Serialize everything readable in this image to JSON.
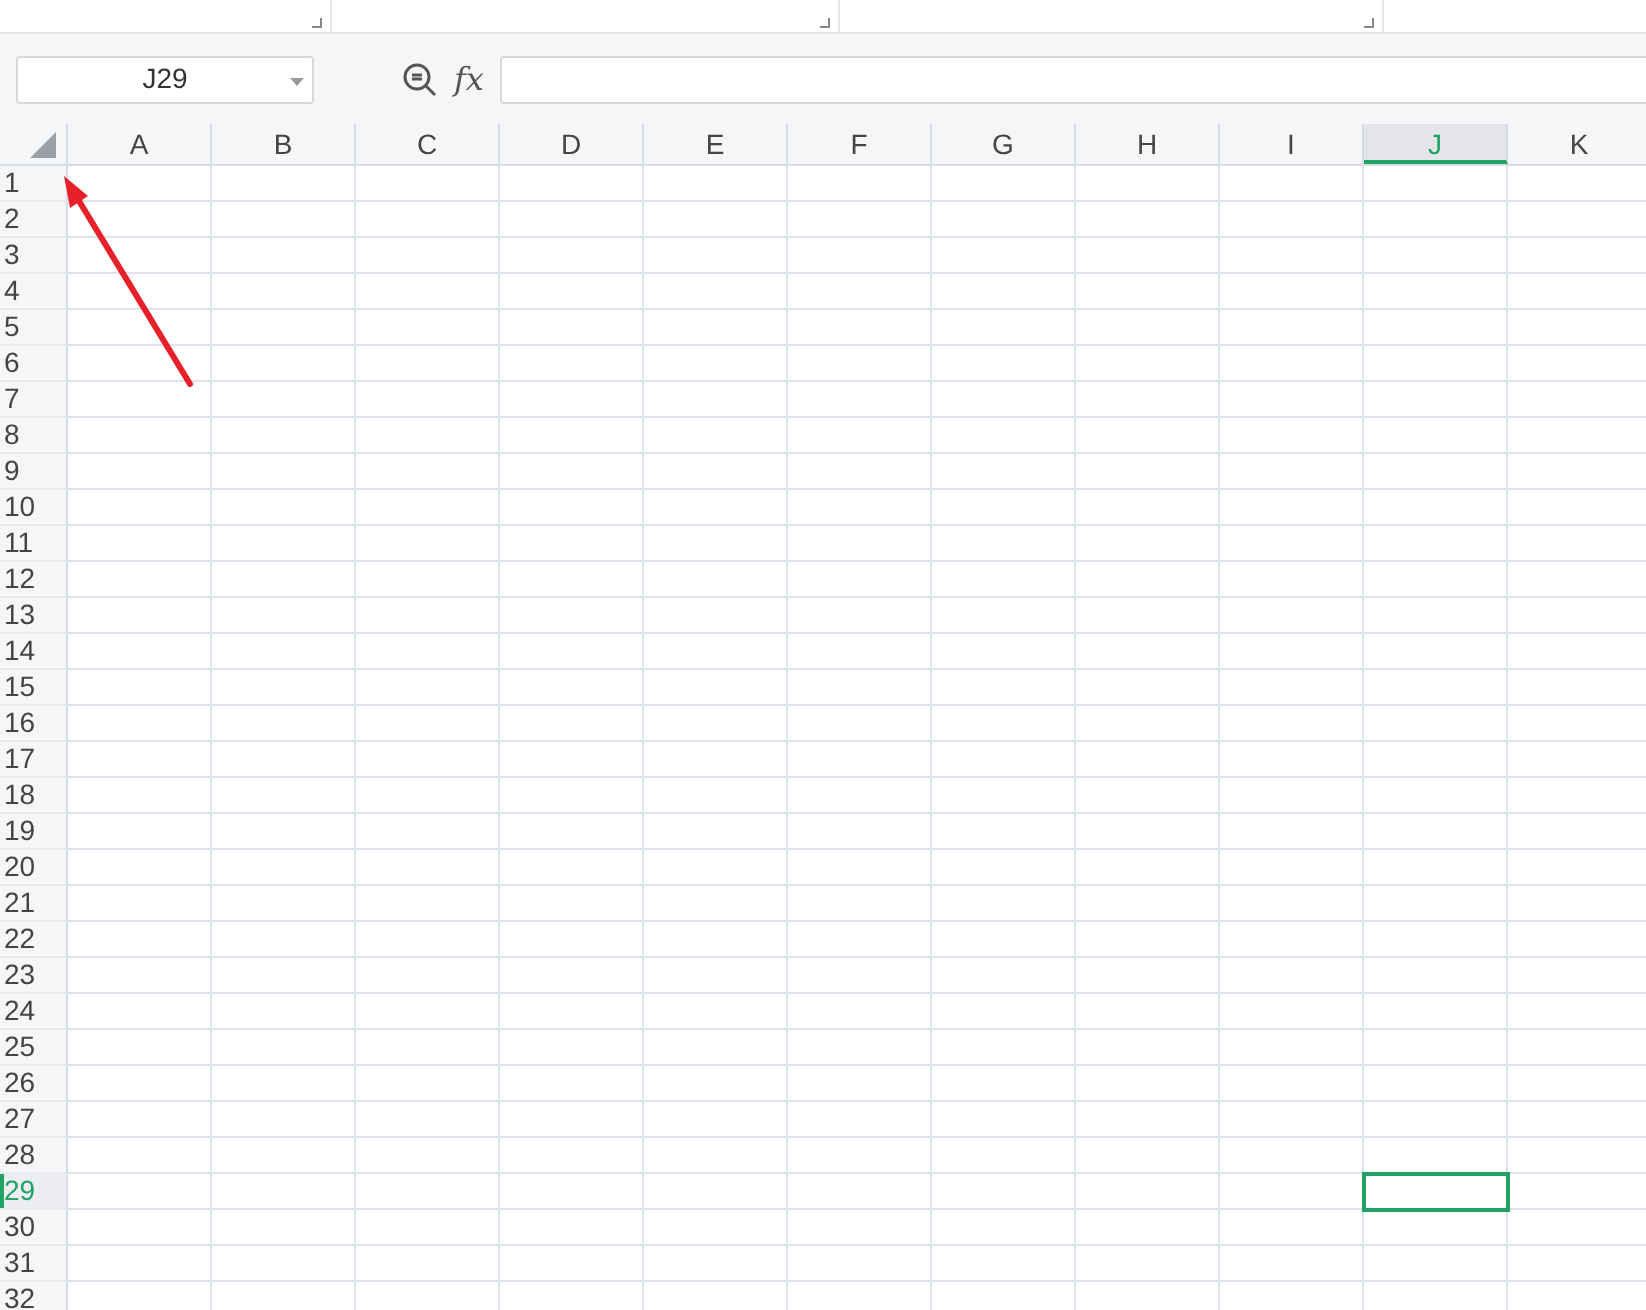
{
  "formula_bar": {
    "name_box": "J29",
    "function_label": "fx"
  },
  "columns": [
    {
      "label": "A",
      "selected": false
    },
    {
      "label": "B",
      "selected": false
    },
    {
      "label": "C",
      "selected": false
    },
    {
      "label": "D",
      "selected": false
    },
    {
      "label": "E",
      "selected": false
    },
    {
      "label": "F",
      "selected": false
    },
    {
      "label": "G",
      "selected": false
    },
    {
      "label": "H",
      "selected": false
    },
    {
      "label": "I",
      "selected": false
    },
    {
      "label": "J",
      "selected": true
    },
    {
      "label": "K",
      "selected": false
    }
  ],
  "rows": [
    {
      "label": "1",
      "selected": false
    },
    {
      "label": "2",
      "selected": false
    },
    {
      "label": "3",
      "selected": false
    },
    {
      "label": "4",
      "selected": false
    },
    {
      "label": "5",
      "selected": false
    },
    {
      "label": "6",
      "selected": false
    },
    {
      "label": "7",
      "selected": false
    },
    {
      "label": "8",
      "selected": false
    },
    {
      "label": "9",
      "selected": false
    },
    {
      "label": "10",
      "selected": false
    },
    {
      "label": "11",
      "selected": false
    },
    {
      "label": "12",
      "selected": false
    },
    {
      "label": "13",
      "selected": false
    },
    {
      "label": "14",
      "selected": false
    },
    {
      "label": "15",
      "selected": false
    },
    {
      "label": "16",
      "selected": false
    },
    {
      "label": "17",
      "selected": false
    },
    {
      "label": "18",
      "selected": false
    },
    {
      "label": "19",
      "selected": false
    },
    {
      "label": "20",
      "selected": false
    },
    {
      "label": "21",
      "selected": false
    },
    {
      "label": "22",
      "selected": false
    },
    {
      "label": "23",
      "selected": false
    },
    {
      "label": "24",
      "selected": false
    },
    {
      "label": "25",
      "selected": false
    },
    {
      "label": "26",
      "selected": false
    },
    {
      "label": "27",
      "selected": false
    },
    {
      "label": "28",
      "selected": false
    },
    {
      "label": "29",
      "selected": true
    },
    {
      "label": "30",
      "selected": false
    },
    {
      "label": "31",
      "selected": false
    },
    {
      "label": "32",
      "selected": false
    }
  ],
  "annotation": {
    "kind": "arrow",
    "color": "#e8202a"
  }
}
